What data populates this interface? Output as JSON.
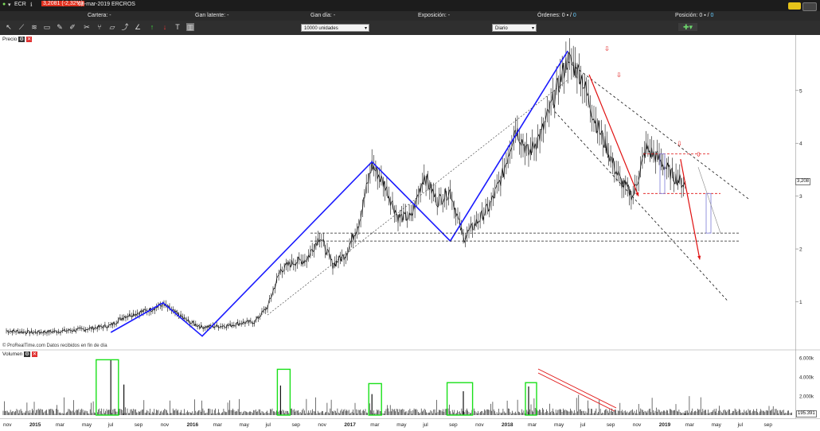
{
  "titlebar": {
    "symbol": "ECR",
    "price_change": "3,2081 (-2,32%)",
    "date_name": "08-mar-2019 ERCROS"
  },
  "account": {
    "fields": [
      {
        "label": "Cartera",
        "value": "-"
      },
      {
        "label": "Gan latente",
        "value": "-"
      },
      {
        "label": "Gan día",
        "value": "-"
      },
      {
        "label": "Exposición",
        "value": "-"
      },
      {
        "label": "Órdenes",
        "value": "0"
      },
      {
        "label": "Posición",
        "value": "0"
      }
    ]
  },
  "toolbar": {
    "quantity": "10000 unidades",
    "timeframe": "Diario"
  },
  "panels": {
    "price_label": "Precio",
    "volume_label": "Volumen",
    "source_note": "© ProRealTime.com  Datos recibidos en fin de día",
    "current_price": "3,208",
    "current_volume": "195.391"
  },
  "colors": {
    "candles": "#111111",
    "trend_lines": "#1a1aff",
    "red_arrows": "#e01010",
    "volume_boxes": "#19e019",
    "support": "#222222"
  },
  "chart_data": [
    {
      "type": "line",
      "name": "ERCROS daily price",
      "y_ticks": [
        1,
        2,
        3,
        4,
        5
      ],
      "ylim": [
        0.3,
        5.9
      ],
      "x_ticks": [
        "nov",
        "2015",
        "mar",
        "may",
        "jul",
        "sep",
        "nov",
        "2016",
        "mar",
        "may",
        "jul",
        "sep",
        "nov",
        "2017",
        "mar",
        "may",
        "jul",
        "sep",
        "nov",
        "2018",
        "mar",
        "may",
        "jul",
        "sep",
        "nov",
        "2019",
        "mar",
        "may",
        "jul",
        "sep"
      ],
      "points": [
        [
          "2014-11",
          0.45
        ],
        [
          "2015-01",
          0.42
        ],
        [
          "2015-03",
          0.44
        ],
        [
          "2015-05",
          0.48
        ],
        [
          "2015-07",
          0.55
        ],
        [
          "2015-08",
          0.72
        ],
        [
          "2015-10",
          0.85
        ],
        [
          "2015-11",
          0.95
        ],
        [
          "2015-12",
          0.78
        ],
        [
          "2016-01",
          0.62
        ],
        [
          "2016-02",
          0.52
        ],
        [
          "2016-04",
          0.55
        ],
        [
          "2016-05",
          0.6
        ],
        [
          "2016-06",
          0.62
        ],
        [
          "2016-07",
          0.9
        ],
        [
          "2016-08",
          1.6
        ],
        [
          "2016-09",
          1.75
        ],
        [
          "2016-10",
          1.8
        ],
        [
          "2016-11",
          2.25
        ],
        [
          "2016-12",
          1.7
        ],
        [
          "2017-01",
          1.9
        ],
        [
          "2017-02",
          2.5
        ],
        [
          "2017-03",
          3.6
        ],
        [
          "2017-04",
          3.2
        ],
        [
          "2017-05",
          2.6
        ],
        [
          "2017-06",
          2.6
        ],
        [
          "2017-07",
          3.4
        ],
        [
          "2017-08",
          2.9
        ],
        [
          "2017-09",
          3.1
        ],
        [
          "2017-10",
          2.2
        ],
        [
          "2017-11",
          2.5
        ],
        [
          "2017-12",
          2.8
        ],
        [
          "2018-01",
          3.4
        ],
        [
          "2018-02",
          4.3
        ],
        [
          "2018-03",
          3.8
        ],
        [
          "2018-04",
          4.2
        ],
        [
          "2018-05",
          4.9
        ],
        [
          "2018-06",
          5.6
        ],
        [
          "2018-07",
          5.3
        ],
        [
          "2018-08",
          4.5
        ],
        [
          "2018-09",
          3.9
        ],
        [
          "2018-10",
          3.3
        ],
        [
          "2018-11",
          3.0
        ],
        [
          "2018-12",
          3.9
        ],
        [
          "2019-01",
          3.7
        ],
        [
          "2019-02",
          3.4
        ],
        [
          "2019-03",
          3.21
        ]
      ],
      "support_levels": [
        2.3,
        2.15
      ],
      "resistance_box": [
        3.05,
        3.8
      ]
    },
    {
      "type": "bar",
      "name": "Volumen",
      "y_ticks": [
        "2.000k",
        "4.000k",
        "6.000k"
      ],
      "ylim": [
        0,
        6000000
      ],
      "spikes": [
        [
          "2015-07",
          5800000
        ],
        [
          "2015-08",
          3200000
        ],
        [
          "2016-08",
          3100000
        ],
        [
          "2017-03",
          2200000
        ],
        [
          "2017-10",
          2500000
        ],
        [
          "2018-03",
          3000000
        ],
        [
          "2019-03",
          195391
        ]
      ]
    }
  ]
}
